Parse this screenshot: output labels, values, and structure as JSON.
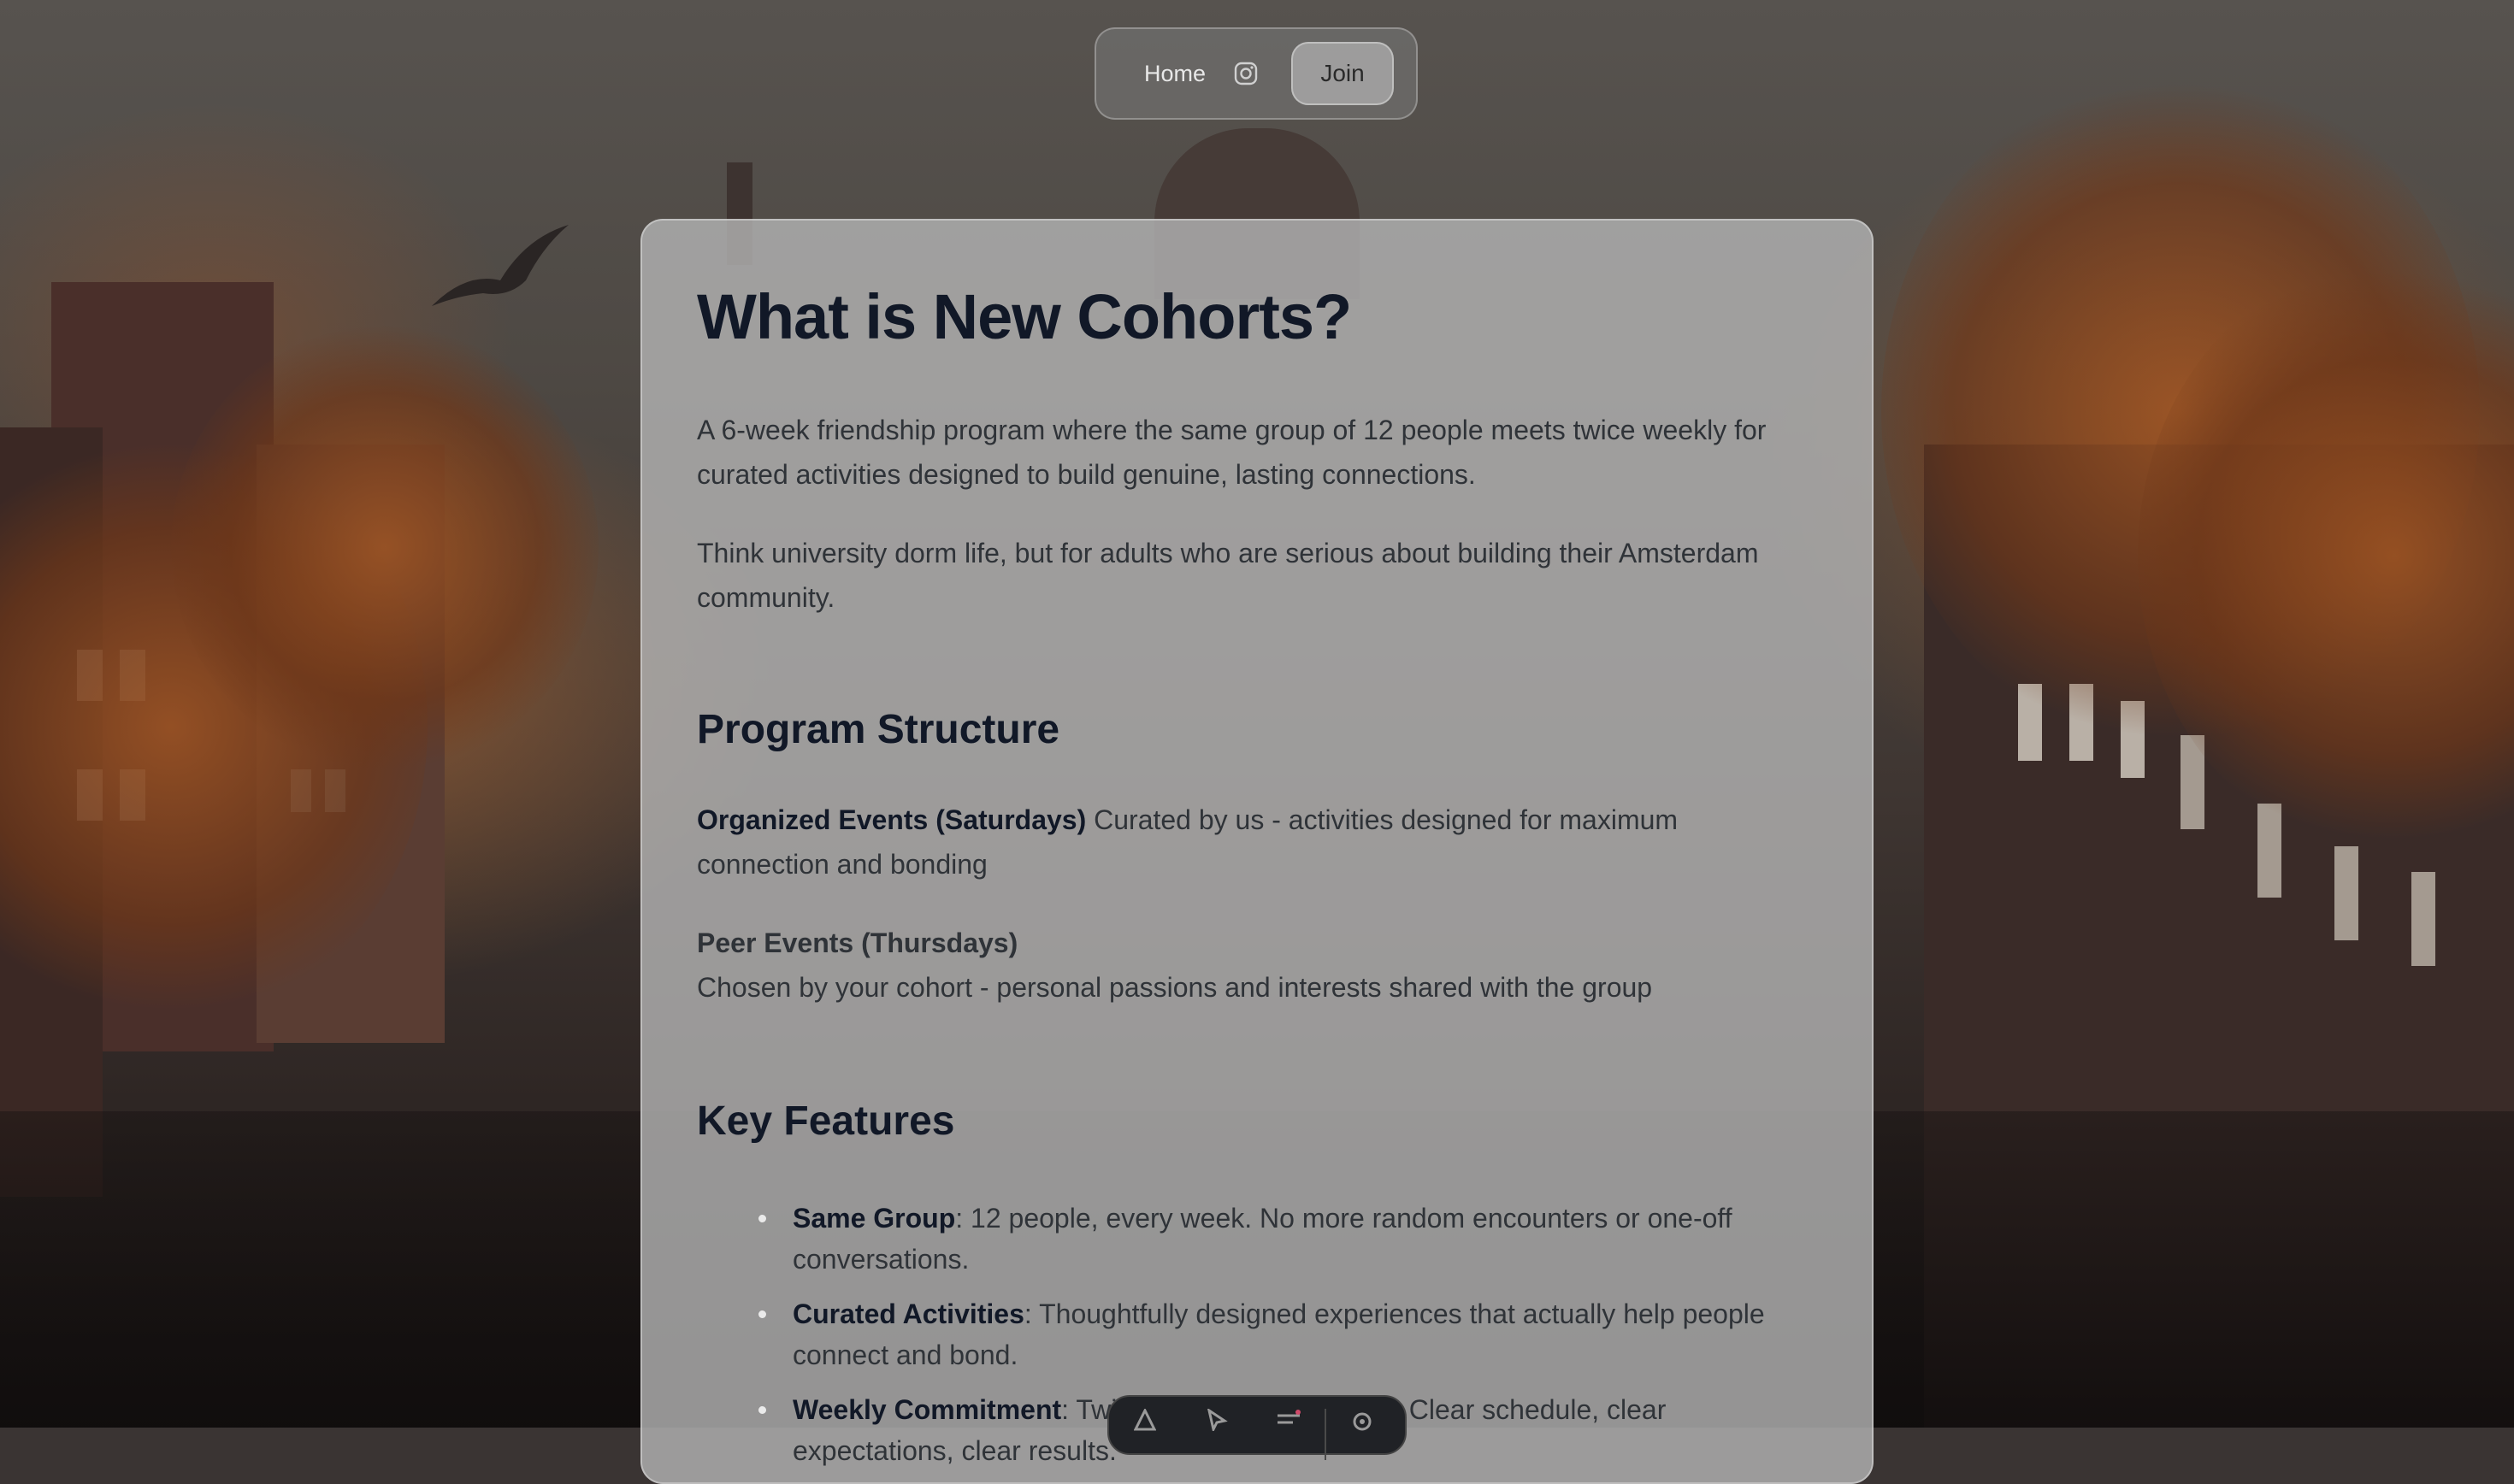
{
  "nav": {
    "home_label": "Home",
    "instagram_icon": "instagram-icon",
    "join_label": "Join"
  },
  "main": {
    "title": "What is New Cohorts?",
    "intro": [
      "A 6-week friendship program where the same group of 12 people meets twice weekly for curated activities designed to build genuine, lasting connections.",
      "Think university dorm life, but for adults who are serious about building their Amsterdam community."
    ],
    "program_structure": {
      "heading": "Program Structure",
      "events": [
        {
          "title": "Organized Events (Saturdays)",
          "description": "Curated by us - activities designed for maximum connection and bonding"
        },
        {
          "title": "Peer Events (Thursdays)",
          "description": "Chosen by your cohort - personal passions and interests shared with the group"
        }
      ]
    },
    "key_features": {
      "heading": "Key Features",
      "items": [
        {
          "title": "Same Group",
          "text": ": 12 people, every week. No more random encounters or one-off conversations."
        },
        {
          "title": "Curated Activities",
          "text": ": Thoughtfully designed experiences that actually help people connect and bond."
        },
        {
          "title": "Weekly Commitment",
          "text": ": Twice weekly commitment. Clear schedule, clear expectations, clear results."
        }
      ]
    }
  },
  "toolbar": {
    "icons": [
      "inspect-icon",
      "cursor-icon",
      "layers-icon",
      "settings-icon"
    ]
  }
}
